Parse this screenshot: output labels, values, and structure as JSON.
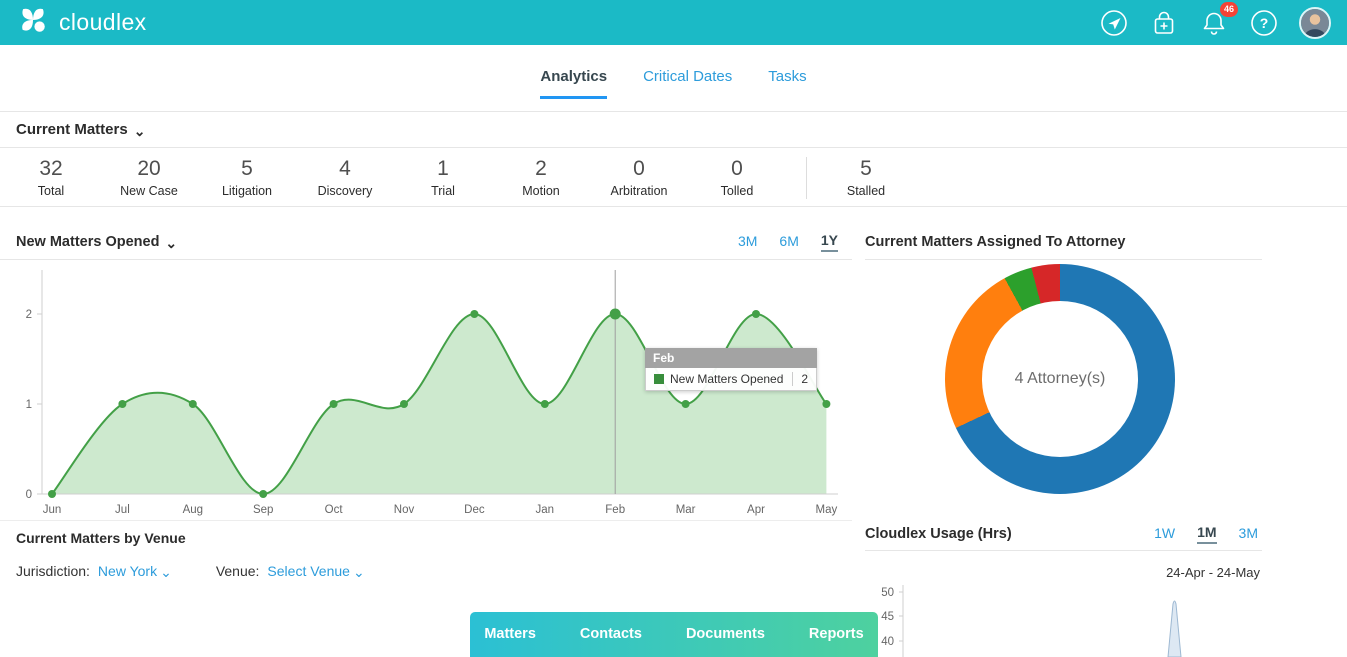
{
  "header": {
    "brand": "cloudlex",
    "notification_count": "46"
  },
  "tabs": {
    "analytics": "Analytics",
    "critical_dates": "Critical Dates",
    "tasks": "Tasks"
  },
  "current_matters": {
    "title": "Current Matters",
    "stats": [
      {
        "value": "32",
        "label": "Total"
      },
      {
        "value": "20",
        "label": "New Case"
      },
      {
        "value": "5",
        "label": "Litigation"
      },
      {
        "value": "4",
        "label": "Discovery"
      },
      {
        "value": "1",
        "label": "Trial"
      },
      {
        "value": "2",
        "label": "Motion"
      },
      {
        "value": "0",
        "label": "Arbitration"
      },
      {
        "value": "0",
        "label": "Tolled"
      },
      {
        "value": "5",
        "label": "Stalled"
      }
    ]
  },
  "new_matters": {
    "title": "New Matters Opened",
    "ranges": [
      "3M",
      "6M",
      "1Y"
    ],
    "active_range": "1Y"
  },
  "tooltip": {
    "title": "Feb",
    "series": "New Matters Opened",
    "value": "2"
  },
  "attorney": {
    "title": "Current Matters Assigned To Attorney",
    "center_label": "4 Attorney(s)"
  },
  "usage": {
    "title": "Cloudlex Usage (Hrs)",
    "ranges": [
      "1W",
      "1M",
      "3M"
    ],
    "active_range": "1M",
    "date_range": "24-Apr - 24-May",
    "yticks": [
      "50",
      "45",
      "40"
    ]
  },
  "venue": {
    "title": "Current Matters by Venue",
    "jurisdiction_label": "Jurisdiction:",
    "jurisdiction_value": "New York",
    "venue_label": "Venue:",
    "venue_value": "Select Venue"
  },
  "bottom_nav": {
    "items": [
      "Matters",
      "Contacts",
      "Documents",
      "Reports"
    ]
  },
  "colors": {
    "header_teal": "#1bbac6",
    "link_blue": "#2d9cdb",
    "active_tab_underline": "#2196f3",
    "nav_gradient_start": "#2bc0d4",
    "nav_gradient_end": "#4ed19f"
  },
  "chart_data": [
    {
      "type": "area",
      "title": "New Matters Opened",
      "x": [
        "Jun",
        "Jul",
        "Aug",
        "Sep",
        "Oct",
        "Nov",
        "Dec",
        "Jan",
        "Feb",
        "Mar",
        "Apr",
        "May"
      ],
      "series": [
        {
          "name": "New Matters Opened",
          "values": [
            0,
            1,
            1,
            0,
            1,
            1,
            2,
            1,
            2,
            1,
            2,
            1
          ]
        }
      ],
      "ylim": [
        0,
        2.45
      ],
      "yticks": [
        0,
        1,
        2
      ],
      "grid": false,
      "legend_position": "none",
      "line_color": "#43a047",
      "fill_color": "rgba(76,175,80,0.28)",
      "crosshair_x": "Feb",
      "tooltip": {
        "x": "Feb",
        "series": "New Matters Opened",
        "value": 2
      }
    },
    {
      "type": "pie",
      "title": "Current Matters Assigned To Attorney",
      "center_label": "4 Attorney(s)",
      "donut": true,
      "slices": [
        {
          "value": 68,
          "color": "#1f77b4"
        },
        {
          "value": 24,
          "color": "#ff7f0e"
        },
        {
          "value": 4,
          "color": "#2ca02c"
        },
        {
          "value": 4,
          "color": "#d62728"
        }
      ]
    },
    {
      "type": "line",
      "title": "Cloudlex Usage (Hrs)",
      "x_range_label": "24-Apr - 24-May",
      "visible_yticks": [
        50,
        45,
        40
      ]
    }
  ]
}
